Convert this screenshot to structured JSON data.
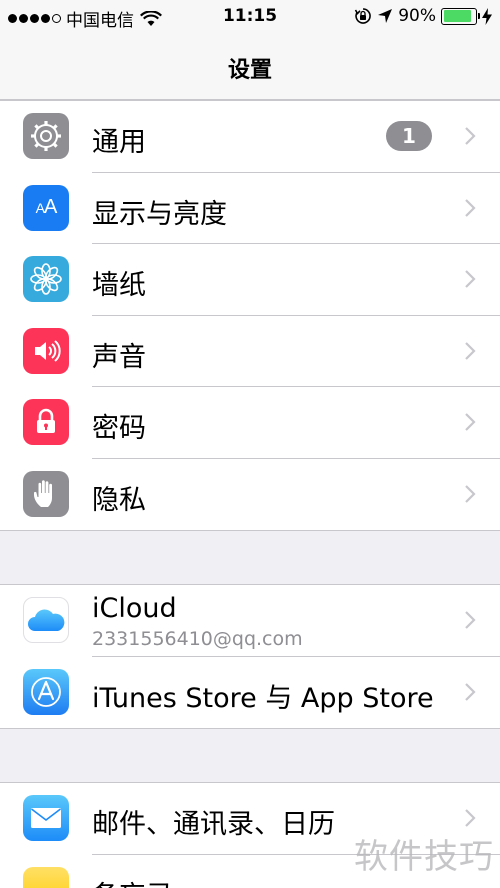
{
  "status_bar": {
    "carrier": "中国电信",
    "time": "11:15",
    "battery": "90%",
    "battery_level": 0.9
  },
  "nav": {
    "title": "设置"
  },
  "colors": {
    "general_icon": "#8e8e93",
    "display_icon": "#1a7cf2",
    "wallpaper_icon": "#36aadc",
    "sounds_icon": "#fd3358",
    "passcode_icon": "#fd3358",
    "privacy_icon": "#8e8e93",
    "appstore_icon": "#1ea2f5",
    "mail_icon": "#1d8cf8",
    "notes_icon": "#ffcc00"
  },
  "group1": [
    {
      "label": "通用",
      "icon": "gear-icon",
      "badge": "1"
    },
    {
      "label": "显示与亮度",
      "icon": "text-size-icon",
      "icon_text": "AA"
    },
    {
      "label": "墙纸",
      "icon": "flower-icon"
    },
    {
      "label": "声音",
      "icon": "speaker-icon"
    },
    {
      "label": "密码",
      "icon": "lock-icon"
    },
    {
      "label": "隐私",
      "icon": "hand-icon"
    }
  ],
  "group2": [
    {
      "label": "iCloud",
      "sublabel": "2331556410@qq.com",
      "icon": "cloud-icon"
    },
    {
      "label": "iTunes Store 与 App Store",
      "icon": "app-store-icon"
    }
  ],
  "group3": [
    {
      "label": "邮件、通讯录、日历",
      "icon": "mail-icon"
    },
    {
      "label": "备忘录",
      "icon": "notes-icon"
    }
  ],
  "watermark": "软件技巧"
}
